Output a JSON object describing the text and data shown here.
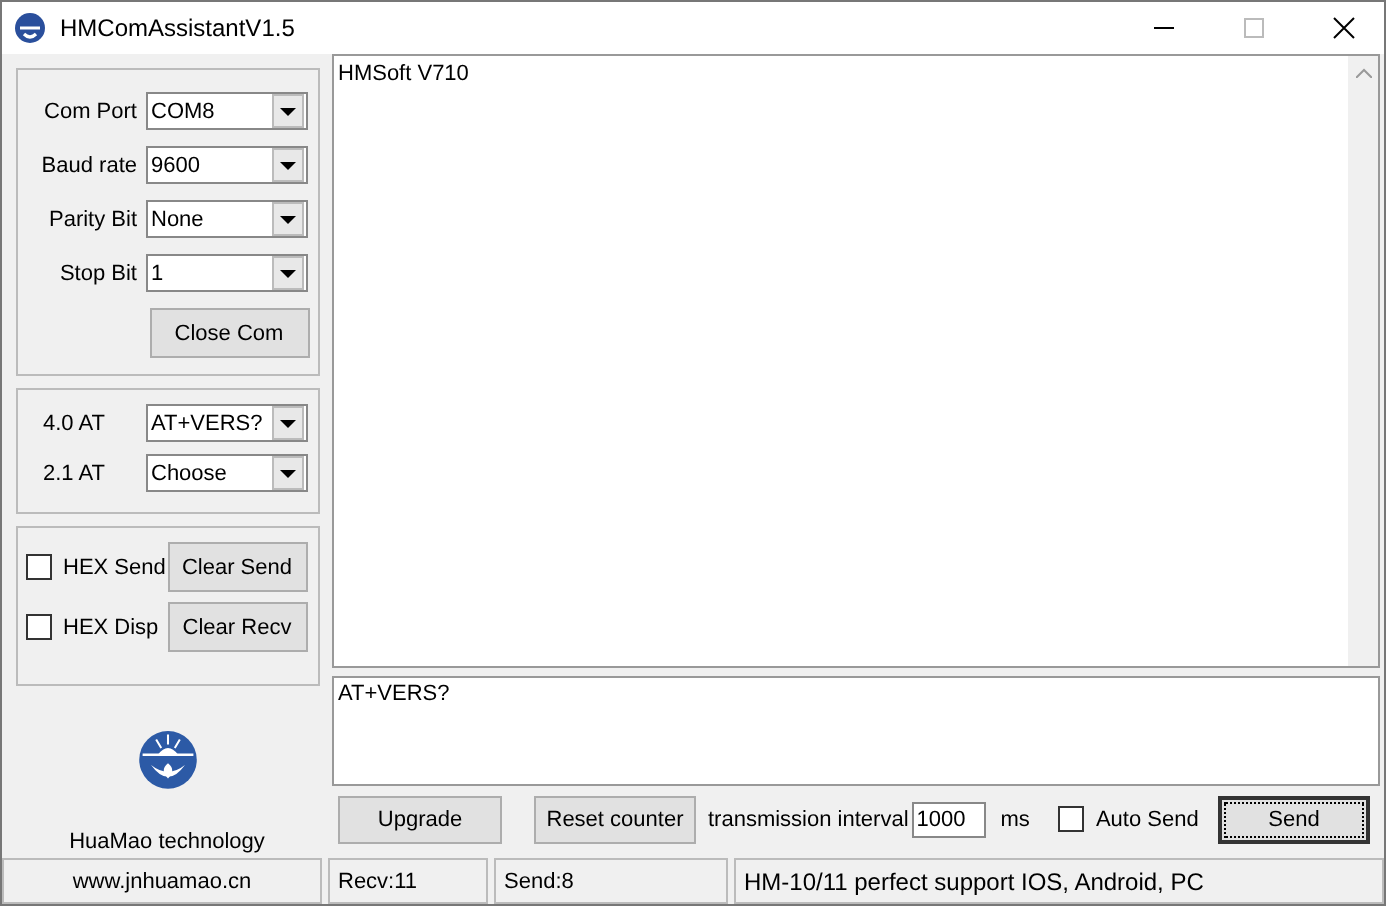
{
  "window": {
    "title": "HMComAssistantV1.5"
  },
  "port_settings": [
    {
      "label": "Com Port",
      "value": "COM8"
    },
    {
      "label": "Baud rate",
      "value": "9600"
    },
    {
      "label": "Parity Bit",
      "value": "None"
    },
    {
      "label": "Stop Bit",
      "value": "1"
    }
  ],
  "close_com_button": "Close Com",
  "at_commands": [
    {
      "label": "4.0 AT",
      "value": "AT+VERS?"
    },
    {
      "label": "2.1 AT",
      "value": "Choose"
    }
  ],
  "hex_options": [
    {
      "label": "HEX Send",
      "checked": false,
      "button": "Clear Send"
    },
    {
      "label": "HEX Disp",
      "checked": false,
      "button": "Clear Recv"
    }
  ],
  "company": "HuaMao technology",
  "receive_text": "HMSoft V710",
  "send_text": "AT+VERS?",
  "bottom_bar": {
    "upgrade": "Upgrade",
    "reset": "Reset counter",
    "interval_label": "transmission interval",
    "interval": "1000",
    "unit": "ms",
    "auto_send": {
      "label": "Auto Send",
      "checked": false
    },
    "send": "Send"
  },
  "status_bar": [
    "www.jnhuamao.cn",
    "Recv:11",
    "Send:8",
    "HM-10/11 perfect support IOS, Android, PC"
  ]
}
